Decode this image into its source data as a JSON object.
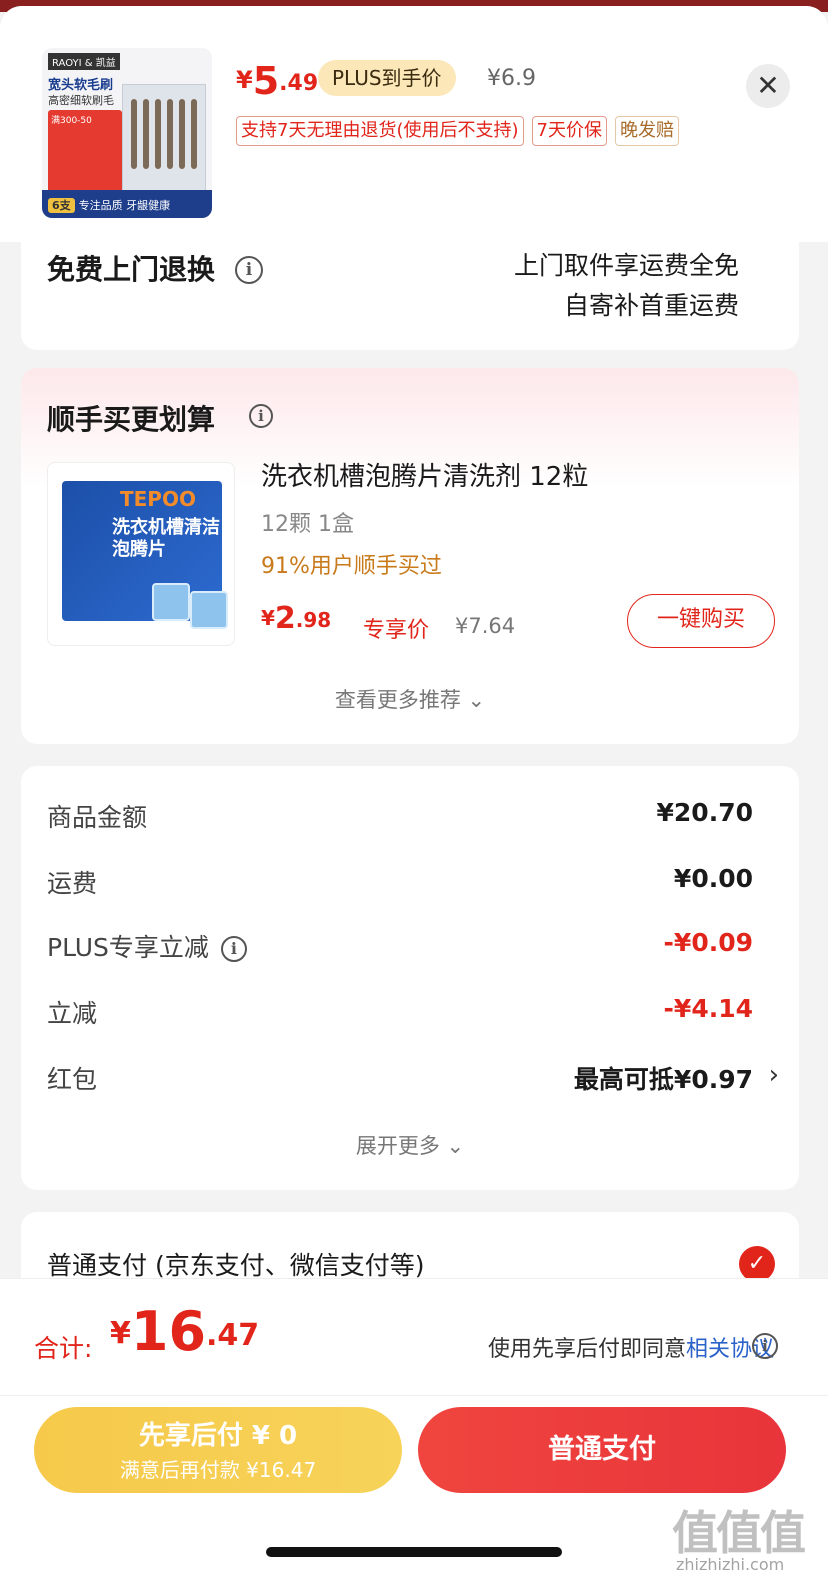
{
  "product": {
    "thumb_brand": "RAOYI & 凯益",
    "thumb_title": "宽头软毛刷",
    "thumb_sub": "高密细软刷毛",
    "thumb_promo": "满300-50",
    "thumb_count": "6支",
    "thumb_slogan": "专注品质 牙龈健康",
    "price_currency": "¥",
    "price_int": "5",
    "price_dec": ".49",
    "plus_label": "PLUS到手价",
    "original_price": "¥6.9",
    "tags": [
      "支持7天无理由退货(使用后不支持)",
      "7天价保",
      "晚发赔"
    ]
  },
  "return_service": {
    "title": "免费上门退换",
    "line1": "上门取件享运费全免",
    "line2": "自寄补首重运费"
  },
  "addon": {
    "title": "顺手买更划算",
    "img_logo": "TEPOO",
    "img_text": "洗衣机槽清洁泡腾片",
    "name": "洗衣机槽泡腾片清洗剂 12粒",
    "spec": "12颗 1盒",
    "buyers": "91%用户顺手买过",
    "price_currency": "¥",
    "price_int": "2",
    "price_dec": ".98",
    "exclusive": "专享价",
    "original_price": "¥7.64",
    "buy_button": "一键购买",
    "more": "查看更多推荐 ⌄"
  },
  "summary": {
    "rows": [
      {
        "label": "商品金额",
        "value": "¥20.70"
      },
      {
        "label": "运费",
        "value": "¥0.00"
      },
      {
        "label": "PLUS专享立减",
        "value": "-¥0.09"
      },
      {
        "label": "立减",
        "value": "-¥4.14"
      },
      {
        "label": "红包",
        "value": "最高可抵¥0.97"
      }
    ],
    "expand": "展开更多 ⌄"
  },
  "payment": {
    "method": "普通支付 (京东支付、微信支付等)"
  },
  "footer": {
    "total_label": "合计:",
    "total_currency": "¥",
    "total_int": "16",
    "total_dec": ".47",
    "agree_prefix": "使用先享后付即同意",
    "agree_link": "相关协议",
    "bnpl_line1": "先享后付 ¥ 0",
    "bnpl_line2": "满意后再付款 ¥16.47",
    "pay_button": "普通支付",
    "watermark": "值值值",
    "watermark_url": "zhizhizhi.com"
  },
  "colors": {
    "accent_red": "#e1251b",
    "plus_gold": "#fbe7b8",
    "bnpl_yellow": "#f6c94a",
    "link_blue": "#2a62c9"
  }
}
